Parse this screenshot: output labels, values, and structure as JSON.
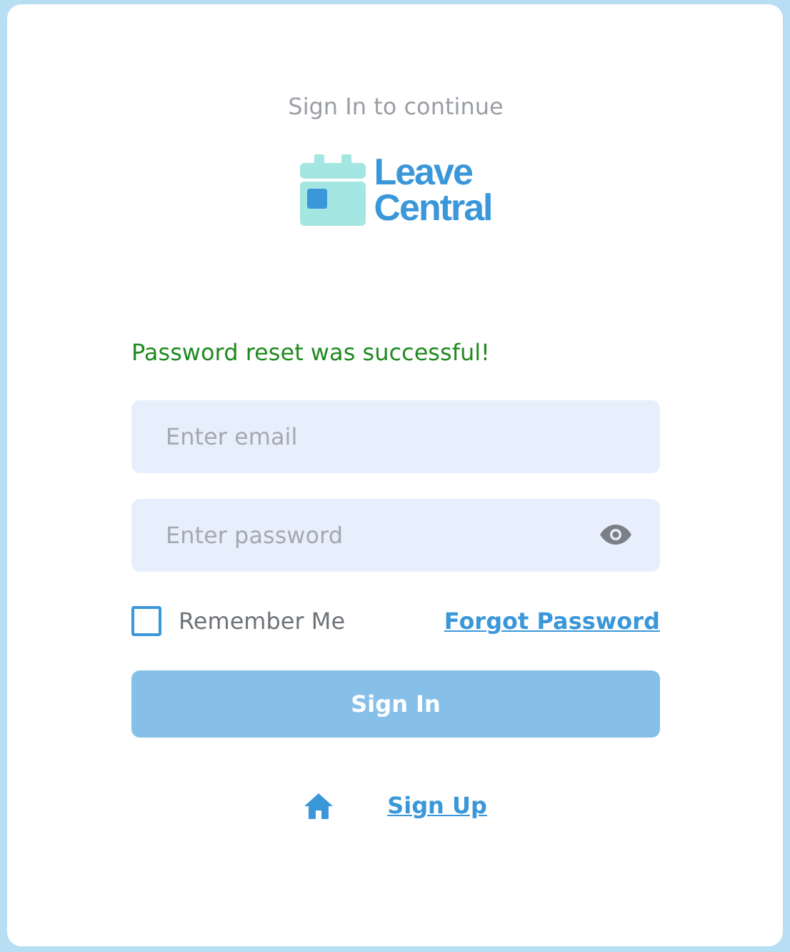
{
  "subtitle": "Sign In to continue",
  "logo": {
    "line_1": "Leave",
    "line_2": "Central"
  },
  "message": {
    "text": "Password reset was successful!",
    "kind": "success"
  },
  "email": {
    "placeholder": "Enter email"
  },
  "password": {
    "placeholder": "Enter password"
  },
  "remember": {
    "label": "Remember Me",
    "checked": false
  },
  "forgot_link": "Forgot Password",
  "sign_in_button": {
    "label": "Sign In",
    "disabled": true
  },
  "sign_up_link": "Sign Up"
}
